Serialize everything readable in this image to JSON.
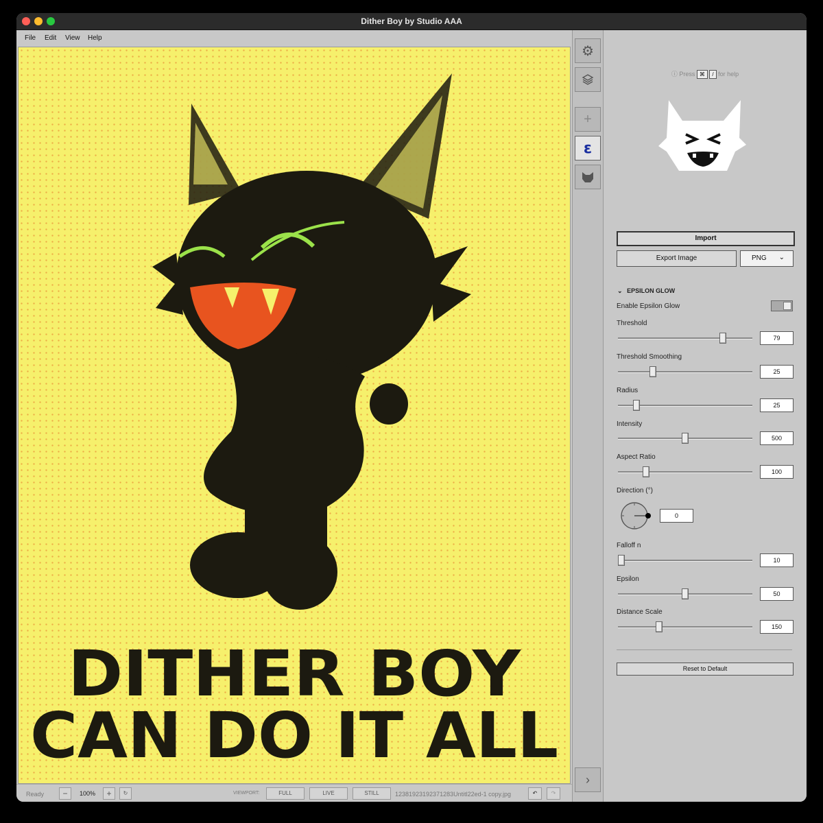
{
  "window": {
    "title": "Dither Boy by Studio AAA"
  },
  "menu": [
    "File",
    "Edit",
    "View",
    "Help"
  ],
  "canvas": {
    "headline_line1": "DITHER BOY",
    "headline_line2": "CAN DO IT ALL"
  },
  "status": {
    "state": "Ready",
    "zoom": "100%",
    "viewport_label": "VIEWPORT:",
    "viewport_modes": [
      "FULL",
      "LIVE",
      "STILL"
    ],
    "filename": "12381923192371283Untitl22ed-1 copy.jpg"
  },
  "tools": [
    "gear-icon",
    "layers-icon",
    "plus-icon",
    "epsilon-icon",
    "cat-icon"
  ],
  "panel": {
    "help_prefix": "Press",
    "help_key1": "⌘",
    "help_key2": "/",
    "help_suffix": "for help",
    "import_label": "Import",
    "export_label": "Export Image",
    "format": "PNG",
    "section_title": "EPSILON GLOW",
    "enable_label": "Enable Epsilon Glow",
    "enabled": false,
    "sliders": [
      {
        "label": "Threshold",
        "value": "79",
        "position": 0.79
      },
      {
        "label": "Threshold Smoothing",
        "value": "25",
        "position": 0.25
      },
      {
        "label": "Radius",
        "value": "25",
        "position": 0.13
      },
      {
        "label": "Intensity",
        "value": "500",
        "position": 0.5
      },
      {
        "label": "Aspect Ratio",
        "value": "100",
        "position": 0.21
      }
    ],
    "direction": {
      "label": "Direction (°)",
      "value": "0"
    },
    "sliders2": [
      {
        "label": "Falloff n",
        "value": "10",
        "position": 0.0
      },
      {
        "label": "Epsilon",
        "value": "50",
        "position": 0.5
      },
      {
        "label": "Distance Scale",
        "value": "150",
        "position": 0.3
      }
    ],
    "reset_label": "Reset to Default"
  },
  "colors": {
    "canvas_bg": "#f6f06c",
    "ink": "#1c1a10",
    "accent_orange": "#e8541f",
    "accent_green": "#9be24a"
  }
}
